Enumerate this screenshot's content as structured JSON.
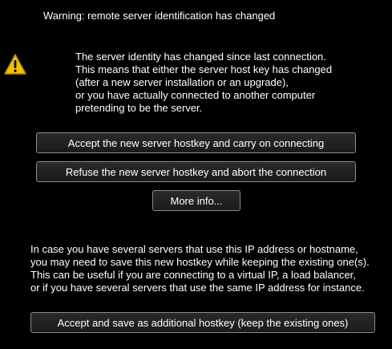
{
  "dialog": {
    "title": "Warning: remote server identification has changed",
    "icon": "warning-triangle-icon",
    "message_lines": [
      "The server identity has changed since last connection.",
      "This means that either the server host key has changed",
      "(after a new server installation or an upgrade),",
      "or you have actually connected to another computer",
      "pretending to be the server."
    ],
    "buttons": {
      "accept": "Accept the new server hostkey and carry on connecting",
      "refuse": "Refuse the new server hostkey and abort the connection",
      "more_info": "More info...",
      "accept_save": "Accept and save as additional hostkey (keep the existing ones)"
    },
    "info_lines": [
      "In case you have several servers that use this IP address or hostname,",
      "you may need to save this new hostkey while keeping the existing one(s).",
      "This can be useful if you are connecting to a virtual IP, a load balancer,",
      "or if you have several servers that use the same IP address for instance."
    ]
  },
  "colors": {
    "background": "#000000",
    "text": "#ffffff",
    "button_border": "#8a8a8a",
    "warning_yellow": "#f2c400"
  }
}
